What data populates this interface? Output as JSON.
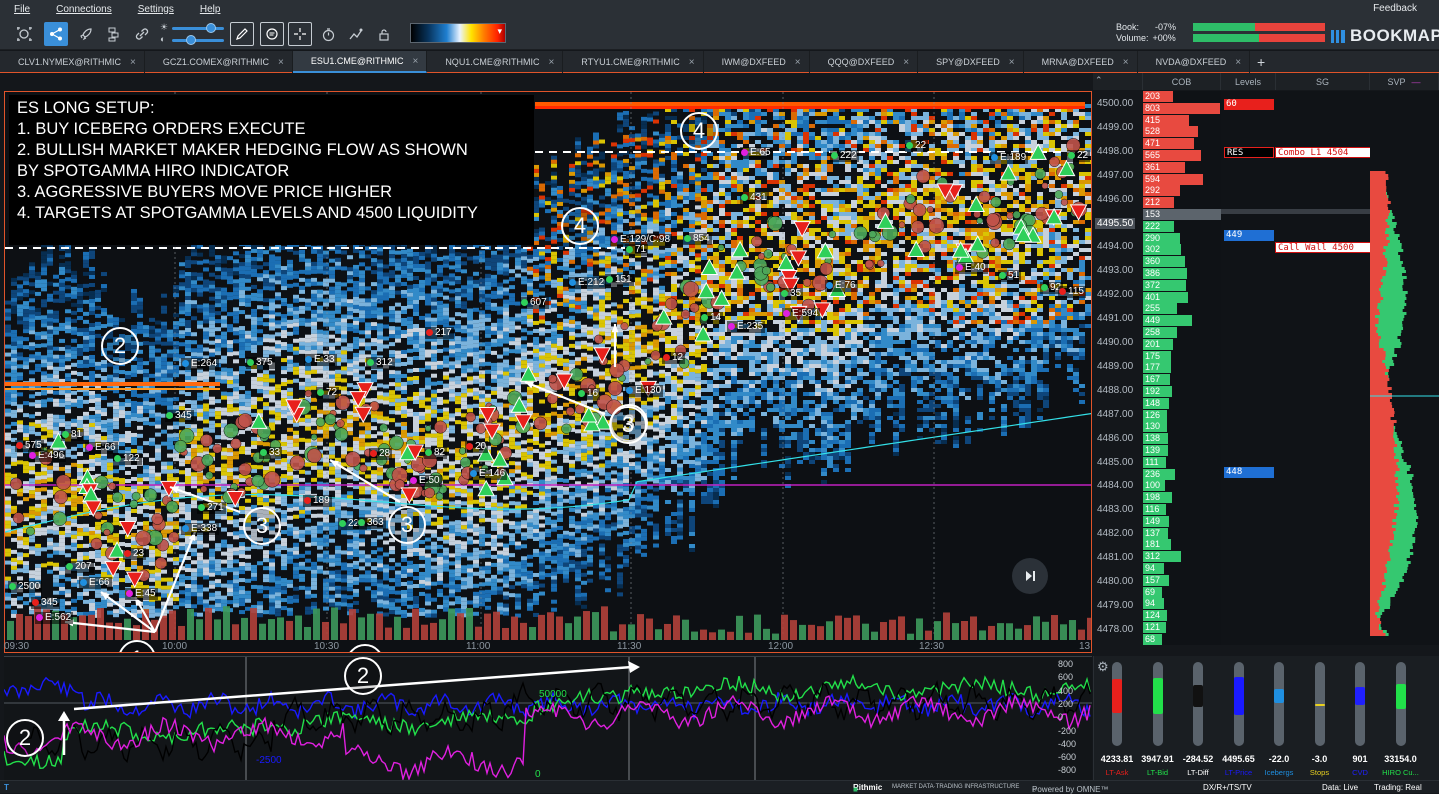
{
  "menu": {
    "file": "File",
    "connections": "Connections",
    "settings": "Settings",
    "help": "Help",
    "feedback": "Feedback"
  },
  "header": {
    "book_label": "Book:",
    "book_value": "-07%",
    "volume_label": "Volume:",
    "volume_value": "+00%",
    "brand": "BOOKMAP",
    "book_meter": {
      "green": 0.47,
      "red": 0.53
    },
    "volume_meter": {
      "green": 0.5,
      "red": 0.5
    },
    "colors": {
      "green": "#2ebd68",
      "red": "#e8433c",
      "accent": "#3a8fd9"
    }
  },
  "toolbar": {
    "icons": [
      "crosshair-settings-icon",
      "share-icon",
      "rocket-icon",
      "layers-icon",
      "link-icon",
      "brightness-slider-icon",
      "pencil-icon",
      "chat-icon",
      "crosshair-icon",
      "timer-icon",
      "chart-settings-icon",
      "lock-icon"
    ],
    "heatmap_legend": "heatmap-color-legend"
  },
  "tabs": [
    {
      "label": "CLV1.NYMEX@RITHMIC",
      "active": false
    },
    {
      "label": "GCZ1.COMEX@RITHMIC",
      "active": false
    },
    {
      "label": "ESU1.CME@RITHMIC",
      "active": true
    },
    {
      "label": "NQU1.CME@RITHMIC",
      "active": false
    },
    {
      "label": "RTYU1.CME@RITHMIC",
      "active": false
    },
    {
      "label": "IWM@DXFEED",
      "active": false
    },
    {
      "label": "QQQ@DXFEED",
      "active": false
    },
    {
      "label": "SPY@DXFEED",
      "active": false
    },
    {
      "label": "MRNA@DXFEED",
      "active": false
    },
    {
      "label": "NVDA@DXFEED",
      "active": false
    }
  ],
  "tab_close": "×",
  "tab_add": "+",
  "columns": {
    "cob": "COB",
    "levels": "Levels",
    "sg": "SG",
    "svp": "SVP"
  },
  "annotation": {
    "lines": [
      "ES LONG SETUP:",
      "1. BUY ICEBERG ORDERS EXECUTE",
      "2. BULLISH MARKET MAKER HEDGING FLOW  AS SHOWN",
      "BY SPOTGAMMA HIRO INDICATOR",
      "3. AGGRESSIVE BUYERS MOVE PRICE HIGHER",
      "4. TARGETS AT SPOTGAMMA LEVELS AND 4500 LIQUIDITY"
    ]
  },
  "callouts": [
    "1",
    "2",
    "2",
    "2",
    "3",
    "3",
    "3",
    "3",
    "4",
    "4"
  ],
  "trade_labels": [
    "E:65",
    "222",
    "22",
    "E:189",
    "22",
    "431",
    "E:129/C:98",
    "854",
    "151",
    "E:212",
    "71",
    "607",
    "E:40",
    "51",
    "92",
    "115",
    "35",
    "E:76",
    "E:594",
    "14",
    "E:235",
    "12",
    "16",
    "E:130",
    "217",
    "E:264",
    "375",
    "E:33",
    "312",
    "72",
    "20",
    "E:146",
    "E:50",
    "28",
    "82",
    "33",
    "E:66",
    "122",
    "E:496",
    "575",
    "81",
    "345",
    "189",
    "221",
    "363",
    "E:338",
    "271",
    "207",
    "23",
    "E:66",
    "E:45",
    "345",
    "E:562",
    "2500"
  ],
  "time_axis": [
    "09:30",
    "10:00",
    "10:30",
    "11:00",
    "11:30",
    "12:00",
    "12:30",
    "13"
  ],
  "price_axis": [
    "4500.00",
    "4499.00",
    "4498.00",
    "4497.00",
    "4496.00",
    "4495.50",
    "4494.00",
    "4493.00",
    "4492.00",
    "4491.00",
    "4490.00",
    "4489.00",
    "4488.00",
    "4487.00",
    "4486.00",
    "4485.00",
    "4484.00",
    "4483.00",
    "4482.00",
    "4481.00",
    "4480.00",
    "4479.00",
    "4478.00"
  ],
  "cob_values": [
    "203",
    "803",
    "415",
    "528",
    "471",
    "565",
    "361",
    "594",
    "292",
    "212",
    "153",
    "222",
    "290",
    "302",
    "360",
    "386",
    "372",
    "401",
    "255",
    "449",
    "258",
    "201",
    "175",
    "177",
    "167",
    "192",
    "148",
    "126",
    "130",
    "138",
    "139",
    "111",
    "236",
    "100",
    "198",
    "116",
    "149",
    "137",
    "181",
    "312",
    "94",
    "157",
    "69",
    "94",
    "124",
    "121",
    "68"
  ],
  "level_tags": [
    {
      "text": "60",
      "color": "#e8201c"
    },
    {
      "text": "RES",
      "color": "#e8201c"
    },
    {
      "text": "449",
      "color": "#1f6fd4"
    },
    {
      "text": "448",
      "color": "#1f6fd4"
    }
  ],
  "sg_tags": [
    "Combo L1 4504",
    "Call Wall 4500"
  ],
  "indicator_axis": [
    "800",
    "600",
    "400",
    "200",
    "0",
    "-200",
    "-400",
    "-600",
    "-800"
  ],
  "indicator_labels": [
    "50000",
    "-2500",
    "0"
  ],
  "sliders": [
    {
      "value": "4233.81",
      "name": "LT-Ask",
      "color": "#e8201c",
      "level": 0.45
    },
    {
      "value": "3947.91",
      "name": "LT-Bid",
      "color": "#22e04a",
      "level": 0.5
    },
    {
      "value": "-284.52",
      "name": "LT-Diff",
      "color": "#111111",
      "level": 0.2
    },
    {
      "value": "4495.65",
      "name": "LT-Price",
      "color": "#1a1aff",
      "level": 0.55
    },
    {
      "value": "-22.0",
      "name": "Icebergs",
      "color": "#1f8fe0",
      "level": 0.02
    },
    {
      "value": "-3.0",
      "name": "Stops",
      "color": "#e8d020",
      "level": 0.0
    },
    {
      "value": "901",
      "name": "CVD",
      "color": "#2020ff",
      "level": 0.1
    },
    {
      "value": "33154.0",
      "name": "HIRO Cu...",
      "color": "#22e04a",
      "level": 0.25
    }
  ],
  "status": {
    "provider": "Rithmic",
    "provider_sub": "MARKET DATA·TRADING INFRASTRUCTURE",
    "powered": "Powered by OMNE™",
    "feed": "DX/R+/TS/TV",
    "data": "Data: Live",
    "trading": "Trading: Real",
    "corner": "T"
  }
}
